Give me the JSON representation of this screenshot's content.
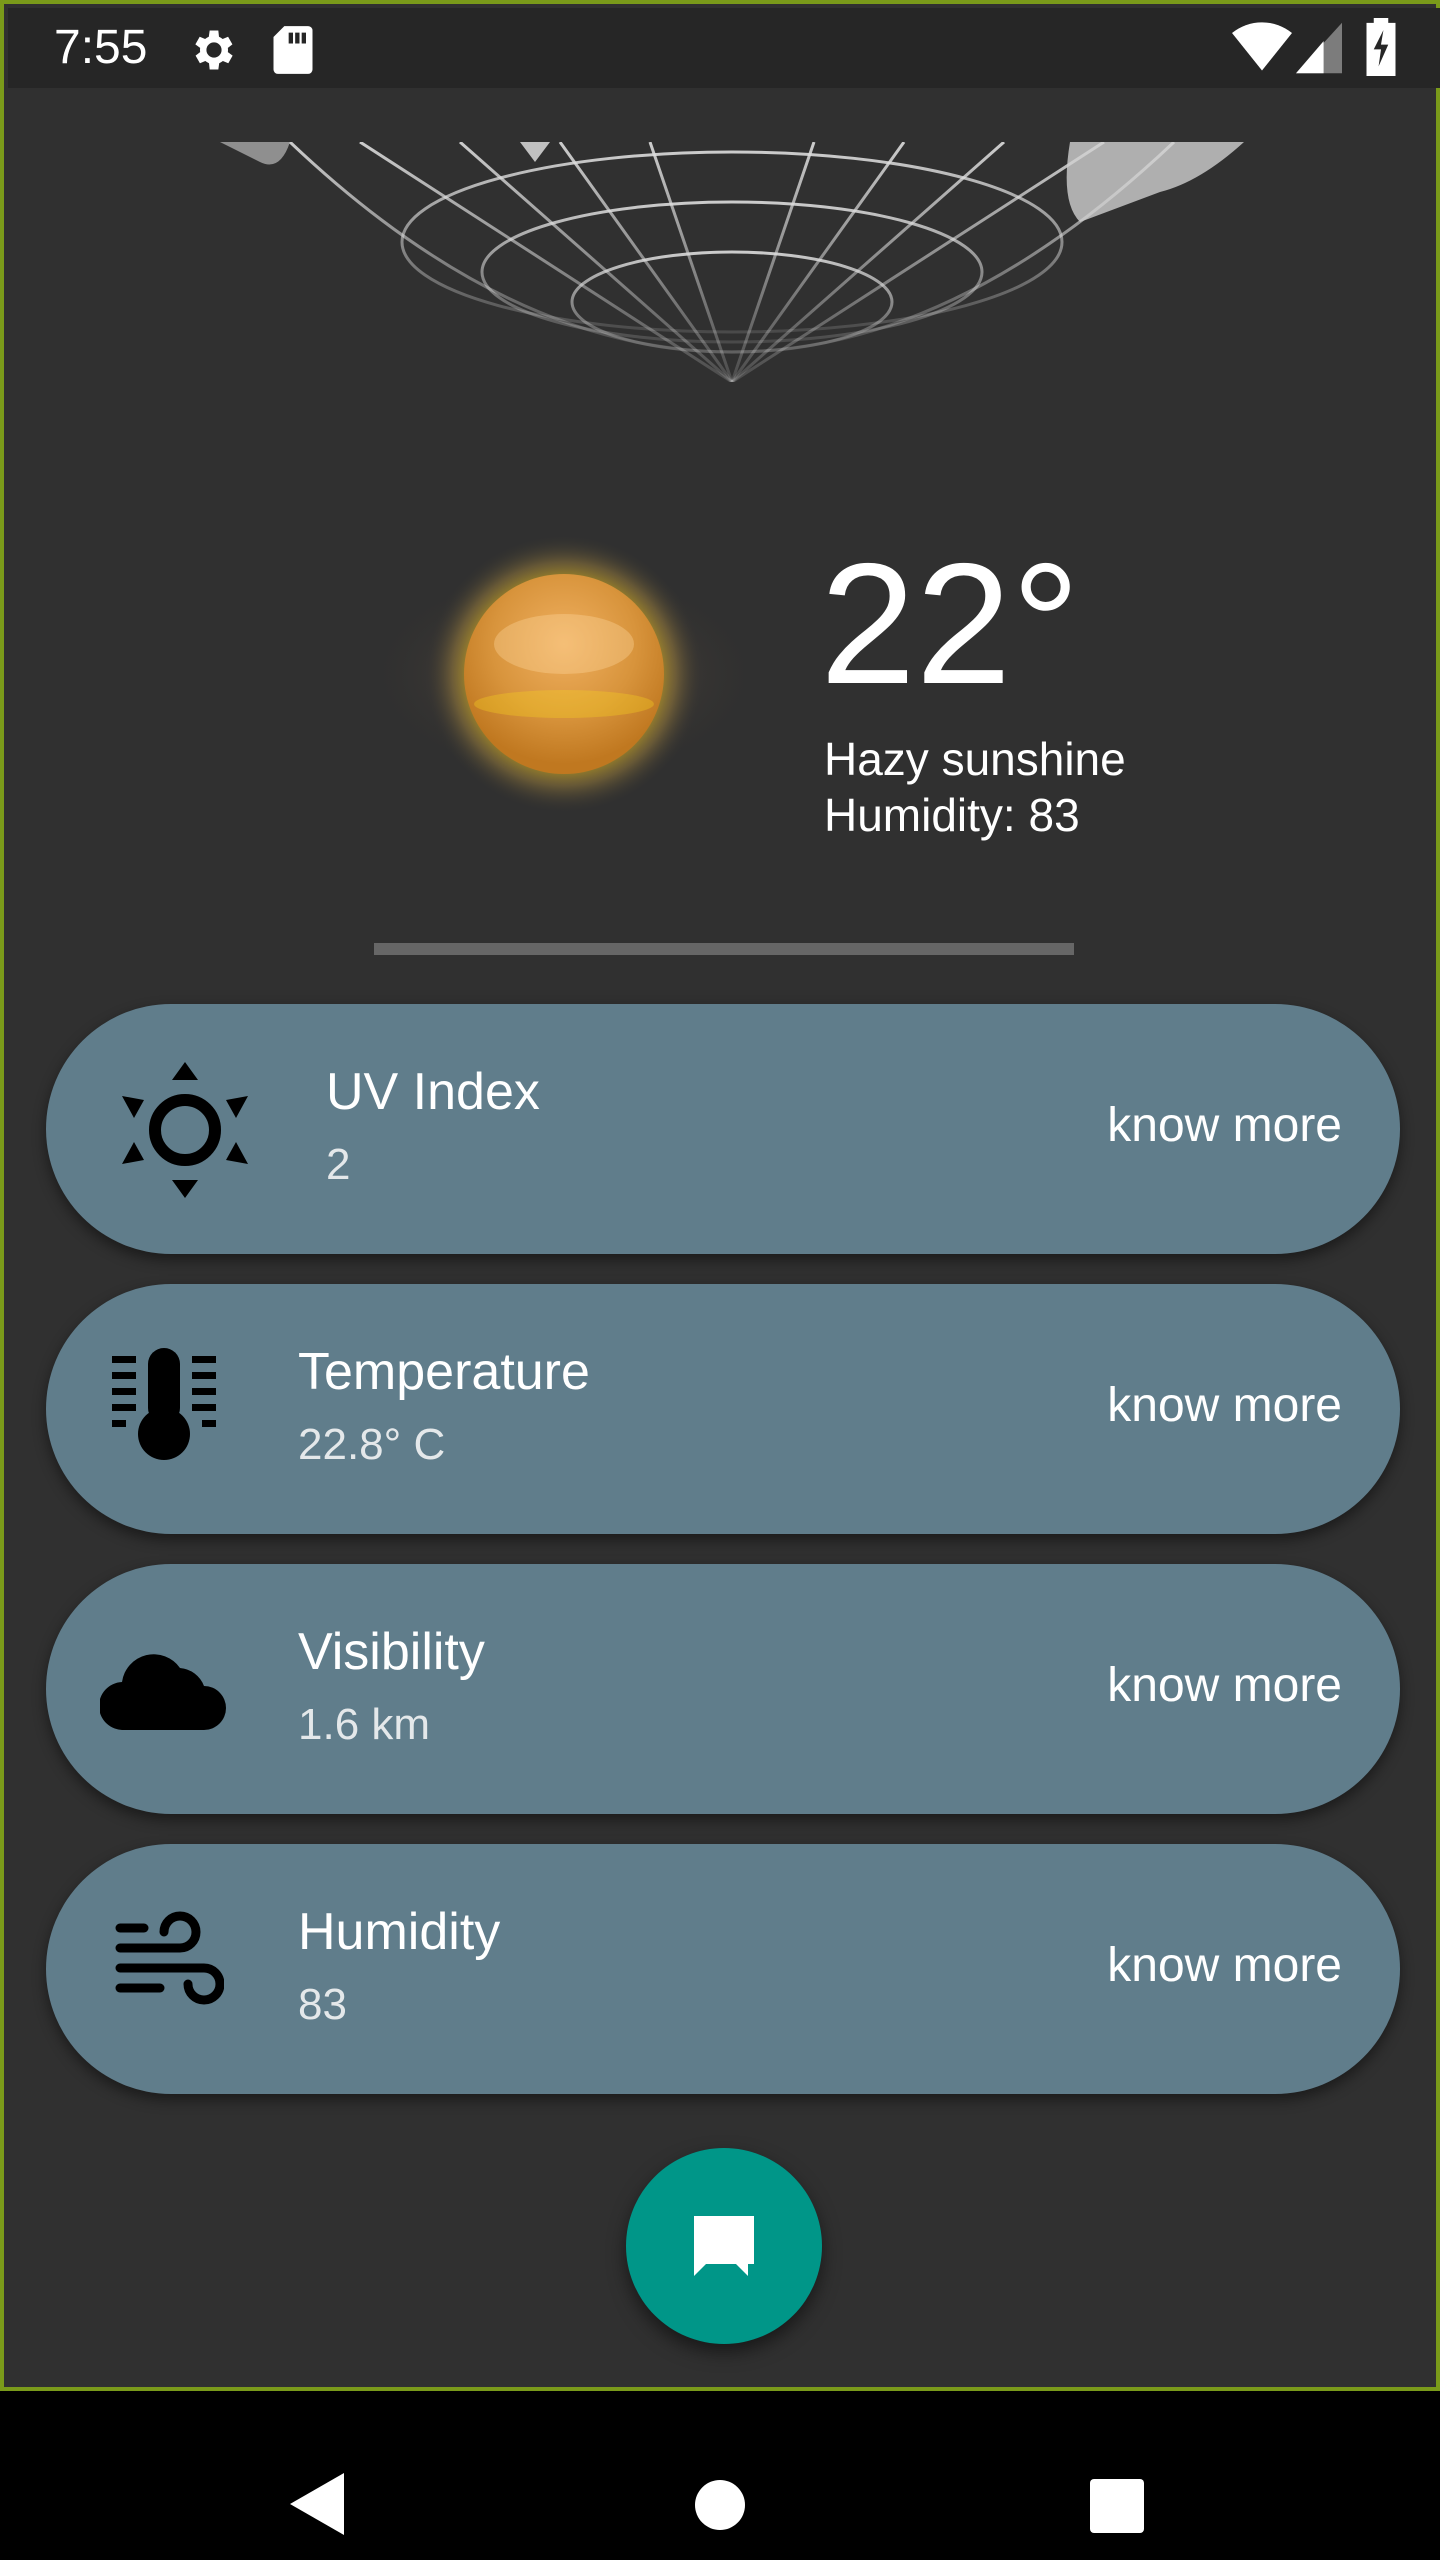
{
  "status_bar": {
    "time": "7:55",
    "icons": [
      "settings-icon",
      "sd-card-icon",
      "wifi-icon",
      "signal-icon",
      "battery-charging-icon"
    ]
  },
  "weather": {
    "temperature": "22°",
    "condition": "Hazy sunshine",
    "humidity_line": "Humidity: 83",
    "illustration": "hazy-sun-icon",
    "header_image": "globe-wireframe"
  },
  "cards": [
    {
      "icon": "uv-sun-icon",
      "title": "UV Index",
      "value": "2",
      "action": "know more"
    },
    {
      "icon": "thermometer-icon",
      "title": "Temperature",
      "value": "22.8° C",
      "action": "know more"
    },
    {
      "icon": "cloud-icon",
      "title": "Visibility",
      "value": "1.6  km",
      "action": "know more"
    },
    {
      "icon": "wind-icon",
      "title": "Humidity",
      "value": "83",
      "action": "know more"
    }
  ],
  "fab": {
    "icon": "chat-icon"
  },
  "nav_bar": {
    "icons": [
      "back-icon",
      "home-icon",
      "recents-icon"
    ]
  },
  "colors": {
    "background": "#303030",
    "card": "#607d8b",
    "fab": "#009688",
    "frame_border": "#7a9a1a"
  }
}
